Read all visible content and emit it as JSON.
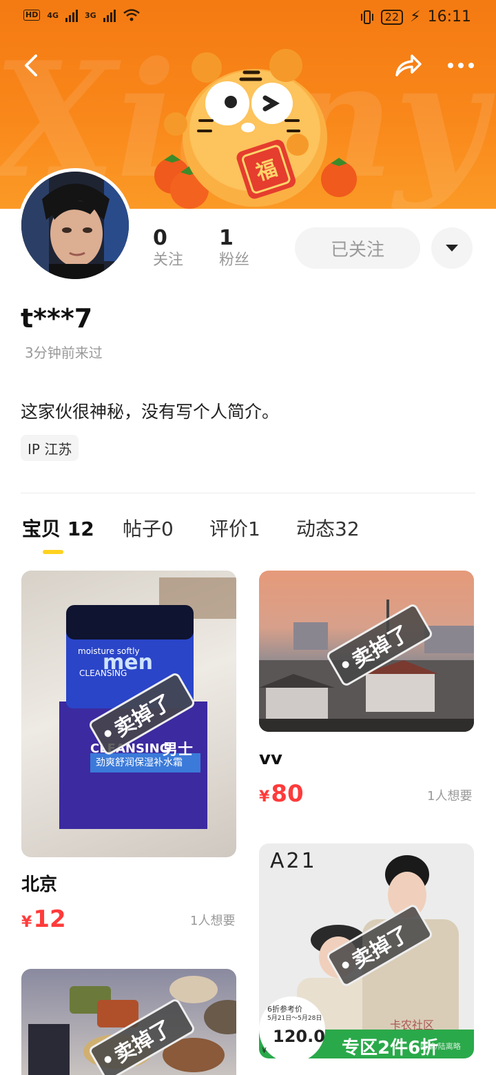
{
  "status": {
    "hd": "HD",
    "net1": "4G",
    "net2": "3G",
    "battery": "22",
    "time": "16:11"
  },
  "header": {
    "back_icon": "chevron-left-icon",
    "share_icon": "share-icon",
    "more_icon": "more-dots-icon",
    "watermark": "Xianyu"
  },
  "profile": {
    "following_count": "0",
    "following_label": "关注",
    "fans_count": "1",
    "fans_label": "粉丝",
    "follow_button": "已关注",
    "username": "t***7",
    "last_seen": "3分钟前来过",
    "bio": "这家伙很神秘，没有写个人简介。",
    "ip_tag": "IP 江苏"
  },
  "tabs": [
    {
      "label": "宝贝",
      "count": "12"
    },
    {
      "label": "帖子",
      "count": "0"
    },
    {
      "label": "评价",
      "count": "1"
    },
    {
      "label": "动态",
      "count": "32"
    }
  ],
  "sold_stamp": "卖掉了",
  "items": [
    {
      "title": "北京",
      "currency": "¥",
      "price": "12",
      "wants": "1人想要",
      "image_text": {
        "line1": "moisture softly",
        "line2": "men",
        "line3": "CLEANSING",
        "line4": "男士",
        "line5": "劲爽舒润保湿补水霜"
      }
    },
    {
      "title": "vv",
      "currency": "¥",
      "price": "80",
      "wants": "1人想要"
    },
    {
      "title": "",
      "image_text": {
        "brand": "A21",
        "ref_label": "6折参考价",
        "dates": "5月21日～5月28日",
        "ref_price": "120.0",
        "currency": "¥",
        "promo": "专区2件6折",
        "watermark": "卡农社区",
        "watermark2": "防骗/陆离略"
      }
    },
    {
      "title": ""
    }
  ],
  "colors": {
    "banner": "#f9871a",
    "price": "#ff3b3b",
    "tab_indicator": "#ffd21f"
  }
}
